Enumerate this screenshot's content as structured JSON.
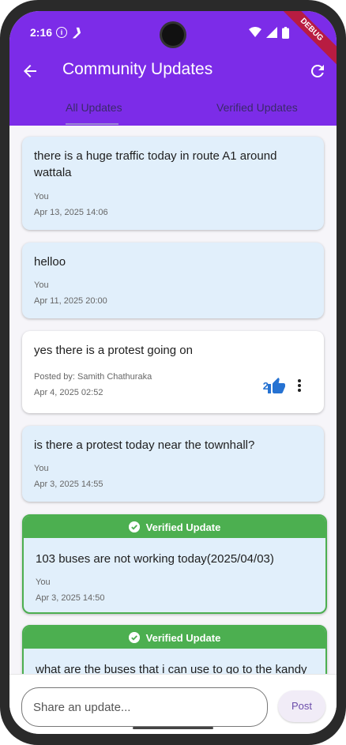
{
  "status": {
    "time": "2:16",
    "info": "i"
  },
  "appbar": {
    "title": "Community Updates",
    "debug": "DEBUG"
  },
  "tabs": [
    {
      "label": "All Updates"
    },
    {
      "label": "Verified Updates"
    }
  ],
  "cards": [
    {
      "message": "there is a huge traffic today in route A1 around wattala",
      "author": "You",
      "date": "Apr 13, 2025 14:06"
    },
    {
      "message": "helloo",
      "author": "You",
      "date": "Apr 11, 2025 20:00"
    },
    {
      "message": "yes there is a protest going on",
      "author": "Posted by: Samith Chathuraka",
      "date": "Apr 4, 2025 02:52",
      "likes": "2"
    },
    {
      "message": "is there a protest today near the townhall?",
      "author": "You",
      "date": "Apr 3, 2025 14:55"
    },
    {
      "badge": "Verified Update",
      "message": "103 buses are not working today(2025/04/03)",
      "author": "You",
      "date": "Apr 3, 2025 14:50"
    },
    {
      "badge": "Verified Update",
      "message": "what are the buses that i can use to go to the kandy"
    }
  ],
  "composer": {
    "placeholder": "Share an update...",
    "post_label": "Post"
  },
  "colors": {
    "primary": "#7c2ce8",
    "verified": "#4caf50",
    "card": "#e1effb"
  }
}
